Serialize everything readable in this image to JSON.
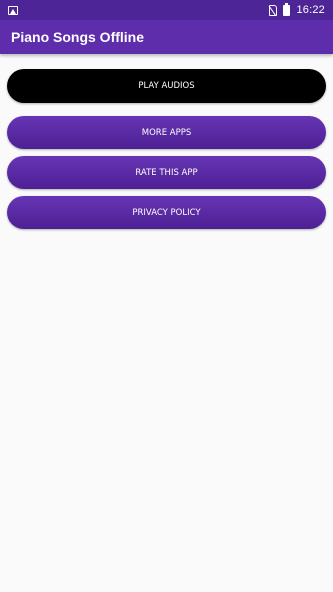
{
  "status_bar": {
    "time": "16:22",
    "icons": [
      "gallery-icon",
      "no-sim-icon",
      "battery-icon"
    ]
  },
  "app_bar": {
    "title": "Piano Songs Offline"
  },
  "buttons": {
    "play_audios": "PLAY AUDIOS",
    "more_apps": "MORE APPS",
    "rate_this_app": "RATE THIS APP",
    "privacy_policy": "PRIVACY POLICY"
  },
  "colors": {
    "status_bar": "#4e2596",
    "app_bar": "#5e2dac",
    "button_purple": "#5a2aa6",
    "button_dark": "#000000",
    "background": "#fafafa"
  }
}
